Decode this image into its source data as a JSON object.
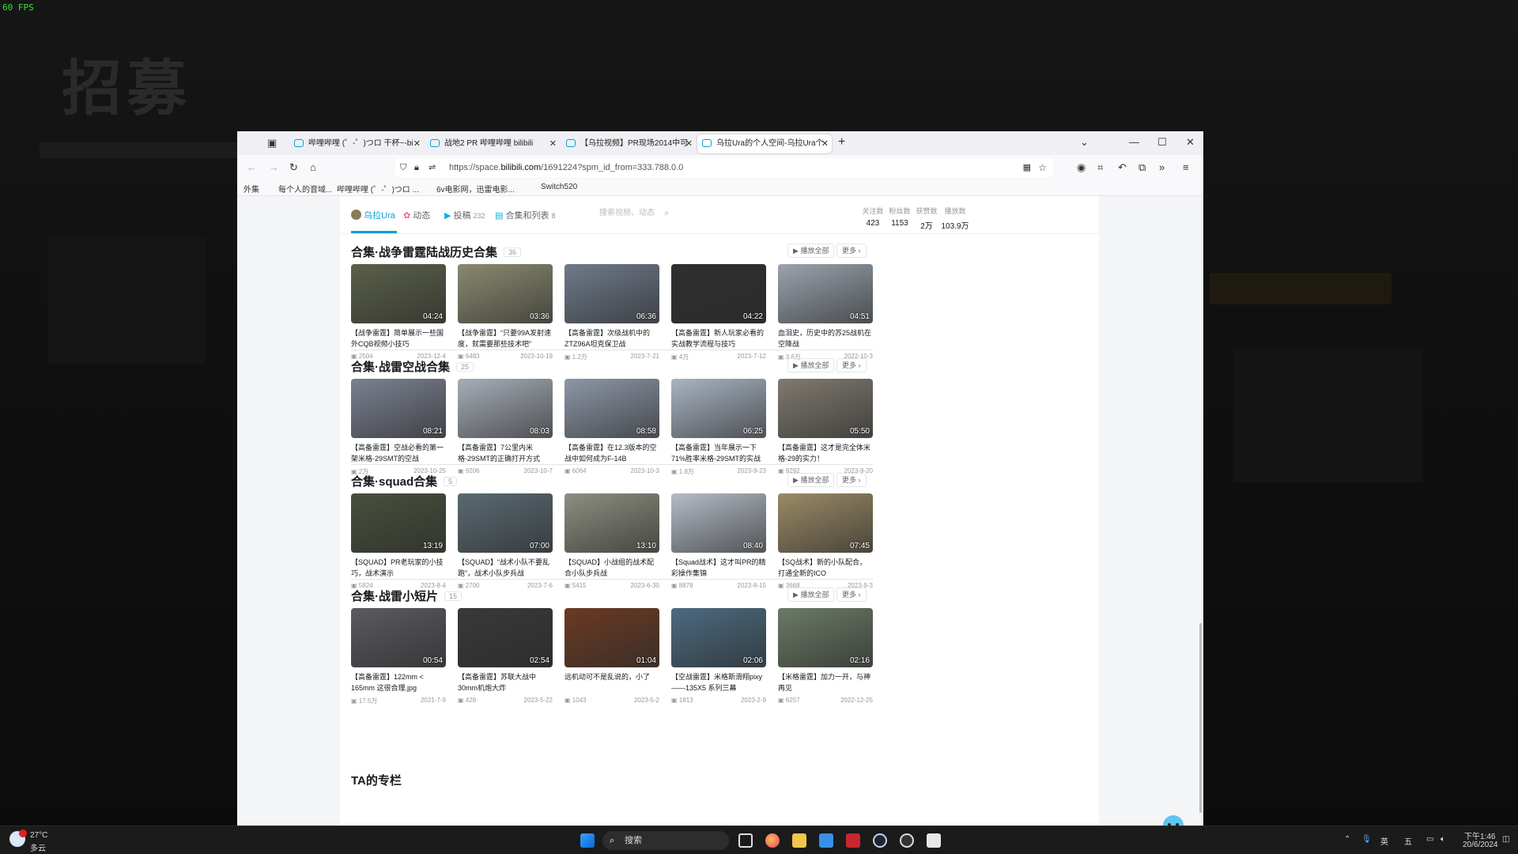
{
  "overlay": {
    "fps": "60 FPS",
    "game_title": "招募"
  },
  "browser": {
    "tabs": [
      {
        "label": "哔哩哔哩 (゜-゜)つロ 干杯~-bi"
      },
      {
        "label": "战地2 PR 哔哩哔哩 bilibili"
      },
      {
        "label": "【乌拉视频】PR现场2014中可"
      },
      {
        "label": "乌拉Ura的个人空间-乌拉Ura个"
      }
    ],
    "url_prefix": "https://space.",
    "url_domain": "bilibili.com",
    "url_suffix": "/1691224?spm_id_from=333.788.0.0",
    "bookmarks": [
      "外集",
      "每个人的音域...",
      "哔哩哔哩 (゜-゜)つロ ...",
      "6v电影网，迅雷电影...",
      "Switch520"
    ]
  },
  "user_nav": {
    "items": [
      {
        "label": "乌拉Ura",
        "count": ""
      },
      {
        "label": "动态",
        "count": ""
      },
      {
        "label": "投稿",
        "count": "232"
      },
      {
        "label": "合集和列表",
        "count": "8"
      }
    ],
    "search_placeholder": "搜索视频、动态",
    "stats": [
      {
        "label": "关注数",
        "value": "423"
      },
      {
        "label": "粉丝数",
        "value": "1153"
      },
      {
        "label": "获赞数",
        "value": "2万"
      },
      {
        "label": "播放数",
        "value": "103.9万"
      }
    ]
  },
  "sections": [
    {
      "title": "合集·战争雷霆陆战历史合集",
      "count": "36",
      "btn_play": "播放全部",
      "btn_more": "更多",
      "videos": [
        {
          "duration": "04:24",
          "title": "【战争雷霆】简单展示一些国外CQB视频小技巧",
          "views": "2504",
          "date": "2023-12-4"
        },
        {
          "duration": "03:36",
          "title": "【战争雷霆】“只要99A发射速度，就需要那些技术吧”",
          "views": "6483",
          "date": "2023-10-19"
        },
        {
          "duration": "06:36",
          "title": "【高备雷霆】次级战机中的ZTZ96A坦克保卫战",
          "views": "1.2万",
          "date": "2023-7-21"
        },
        {
          "duration": "04:22",
          "title": "【高备雷霆】新人玩家必看的实战教学流程与技巧",
          "views": "4万",
          "date": "2023-7-12"
        },
        {
          "duration": "04:51",
          "title": "血泪史，历史中的苏25战机在空降战",
          "views": "3.6万",
          "date": "2022-10-3"
        }
      ]
    },
    {
      "title": "合集·战雷空战合集",
      "count": "25",
      "btn_play": "播放全部",
      "btn_more": "更多",
      "videos": [
        {
          "duration": "08:21",
          "title": "【高备雷霆】空战必看的第一架米格-29SMT的空战",
          "views": "2万",
          "date": "2023-10-25"
        },
        {
          "duration": "08:03",
          "title": "【高备雷霆】7公里内米格-29SMT的正确打开方式",
          "views": "9206",
          "date": "2023-10-7"
        },
        {
          "duration": "08:58",
          "title": "【高备雷霆】在12.3版本的空战中如何成为F-14B",
          "views": "6064",
          "date": "2023-10-3"
        },
        {
          "duration": "06:25",
          "title": "【高备雷霆】当年展示一下71%胜率米格-29SMT的实战",
          "views": "1.8万",
          "date": "2023-9-23"
        },
        {
          "duration": "05:50",
          "title": "【高备雷霆】这才是完全体米格-29的实力！",
          "views": "9292",
          "date": "2023-9-20"
        }
      ]
    },
    {
      "title": "合集·squad合集",
      "count": "5",
      "btn_play": "播放全部",
      "btn_more": "更多",
      "videos": [
        {
          "duration": "13:19",
          "title": "【SQUAD】PR老玩家的小技巧，战术演示",
          "views": "5824",
          "date": "2023-8-4"
        },
        {
          "duration": "07:00",
          "title": "【SQUAD】“战术小队不要乱跑”，战术小队步兵战",
          "views": "2700",
          "date": "2023-7-6"
        },
        {
          "duration": "13:10",
          "title": "【SQUAD】小战组的战术配合小队步兵战",
          "views": "5415",
          "date": "2023-6-30"
        },
        {
          "duration": "08:40",
          "title": "【Squad战术】这才叫PR的精彩操作集锦",
          "views": "8878",
          "date": "2023-8-15"
        },
        {
          "duration": "07:45",
          "title": "【SQ战术】新的小队配合，打通全新的ICO",
          "views": "3668",
          "date": "2023-9-3"
        }
      ]
    },
    {
      "title": "合集·战雷小短片",
      "count": "15",
      "btn_play": "播放全部",
      "btn_more": "更多",
      "videos": [
        {
          "duration": "00:54",
          "title": "【高备雷霆】122mm < 165mm 这很合理.jpg",
          "views": "17.5万",
          "date": "2021-7-9"
        },
        {
          "duration": "02:54",
          "title": "【高备雷霆】苏联大战中30mm机炮大炸",
          "views": "428",
          "date": "2023-5-22"
        },
        {
          "duration": "01:04",
          "title": "远机动可不是乱说的，小了",
          "views": "1043",
          "date": "2023-5-2"
        },
        {
          "duration": "02:06",
          "title": "【空战雷霆】米格斯滑翔pixy——135X5 系列三幕",
          "views": "1813",
          "date": "2023-2-9"
        },
        {
          "duration": "02:16",
          "title": "【米格雷霆】加力一开，与神再见",
          "views": "6257",
          "date": "2022-12-25"
        }
      ]
    }
  ],
  "column_title": "TA的专栏",
  "taskbar": {
    "weather_temp": "27°C",
    "weather_desc": "多云",
    "search": "搜索",
    "ime": "英",
    "time": "下午1:46",
    "date": "20/6/2024"
  }
}
